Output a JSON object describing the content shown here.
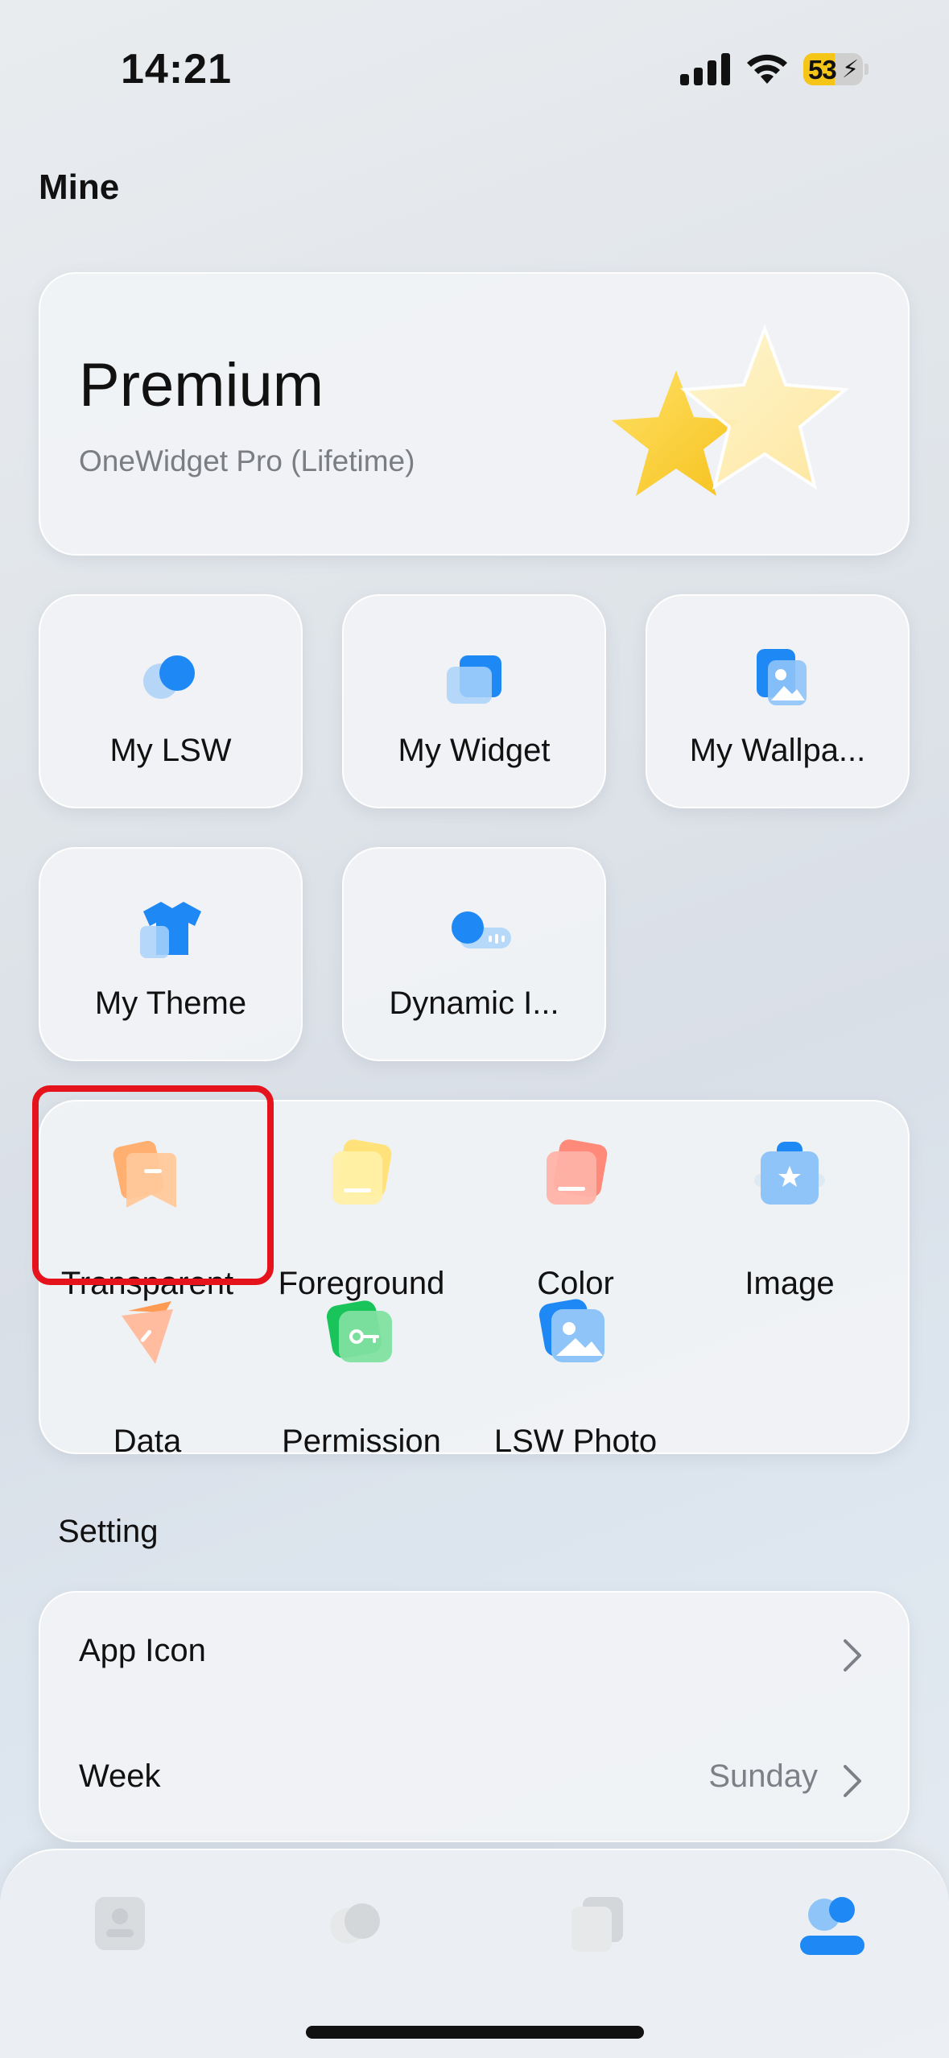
{
  "status_bar": {
    "time": "14:21",
    "battery_percent": "53",
    "battery_level": 0.53,
    "battery_color": "#f5c518"
  },
  "page": {
    "title": "Mine"
  },
  "premium": {
    "title": "Premium",
    "subtitle": "OneWidget Pro (Lifetime)",
    "icon": "stars-icon"
  },
  "my_items": [
    {
      "label": "My LSW",
      "icon": "lsw-icon"
    },
    {
      "label": "My Widget",
      "icon": "widget-icon"
    },
    {
      "label": "My Wallpa...",
      "icon": "wallpaper-icon"
    },
    {
      "label": "My Theme",
      "icon": "theme-shirt-icon"
    },
    {
      "label": "Dynamic I...",
      "icon": "dynamic-island-icon"
    }
  ],
  "features": [
    {
      "label": "Transparent",
      "icon": "transparent-icon",
      "highlighted": true
    },
    {
      "label": "Foreground",
      "icon": "foreground-icon"
    },
    {
      "label": "Color",
      "icon": "color-icon"
    },
    {
      "label": "Image",
      "icon": "image-icon"
    },
    {
      "label": "Data",
      "icon": "data-icon"
    },
    {
      "label": "Permission",
      "icon": "permission-key-icon"
    },
    {
      "label": "LSW Photo",
      "icon": "lsw-photo-icon"
    }
  ],
  "settings": {
    "section_title": "Setting",
    "rows": [
      {
        "label": "App Icon",
        "value": ""
      },
      {
        "label": "Week",
        "value": "Sunday"
      }
    ]
  },
  "tabs": [
    {
      "icon": "contact-card-icon",
      "active": false
    },
    {
      "icon": "circles-icon",
      "active": false
    },
    {
      "icon": "cards-icon",
      "active": false
    },
    {
      "icon": "profile-icon",
      "active": true
    }
  ],
  "colors": {
    "accent_blue": "#1e88f5",
    "highlight_red": "#e5141c",
    "star_yellow": "#fbd84a"
  }
}
